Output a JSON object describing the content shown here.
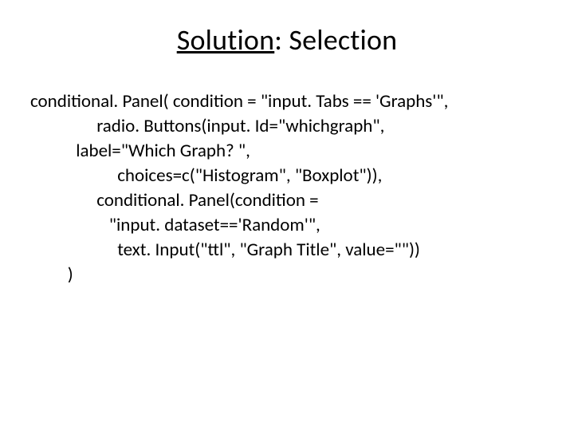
{
  "title": {
    "underlined": "Solution",
    "rest": ": Selection"
  },
  "code": {
    "l1": "conditional. Panel( condition = \"input. Tabs == 'Graphs'\",",
    "l2": "                radio. Buttons(input. Id=\"whichgraph\",",
    "l3": "           label=\"Which Graph? \",",
    "l4": "                     choices=c(\"Histogram\", \"Boxplot\")),",
    "l5": "                conditional. Panel(condition =",
    "l6": "                   \"input. dataset=='Random'\",",
    "l7": "                     text. Input(\"ttl\", \"Graph Title\", value=\"\"))",
    "l8": "         )"
  }
}
